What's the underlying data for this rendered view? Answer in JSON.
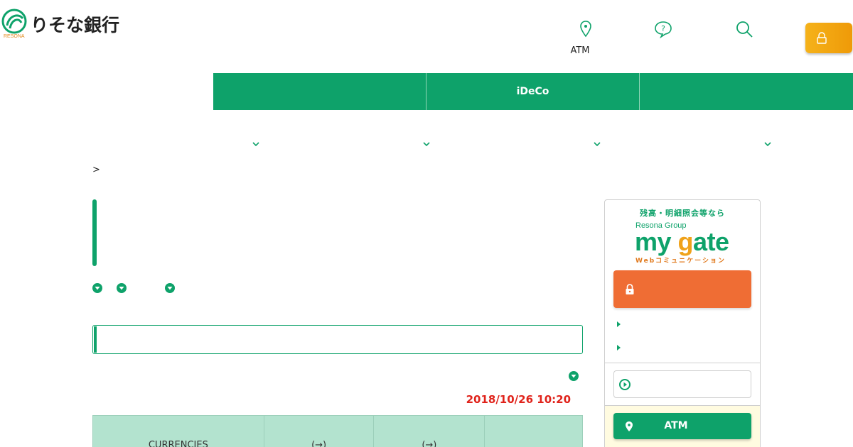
{
  "header": {
    "logo_text": "りそな銀行",
    "logo_sub": "RESONA",
    "atm_label": "ATM",
    "icons": [
      "map-pin-icon",
      "help-bubble-icon",
      "search-icon",
      "lock-icon"
    ]
  },
  "global_nav": {
    "items": [
      {
        "label": ""
      },
      {
        "label": "iDeCo"
      },
      {
        "label": ""
      }
    ]
  },
  "breadcrumb": {
    "separator": ">"
  },
  "rate_table": {
    "timestamp": "2018/10/26 10:20",
    "headers": [
      "CURRENCIES",
      "(→)",
      "(→)",
      ""
    ]
  },
  "sidebar": {
    "caption": "残高・明細照会等なら",
    "group_label": "Resona Group",
    "brand_pre": "my ",
    "brand_g": "g",
    "brand_post": "ate",
    "brand_sub": "Webコミュニケーション",
    "atm_button": "ATM"
  },
  "colors": {
    "brand_green": "#0ea26a",
    "login_orange": "#ef9a08",
    "mygate_orange": "#ef6d34",
    "timestamp_red": "#e0231b"
  }
}
